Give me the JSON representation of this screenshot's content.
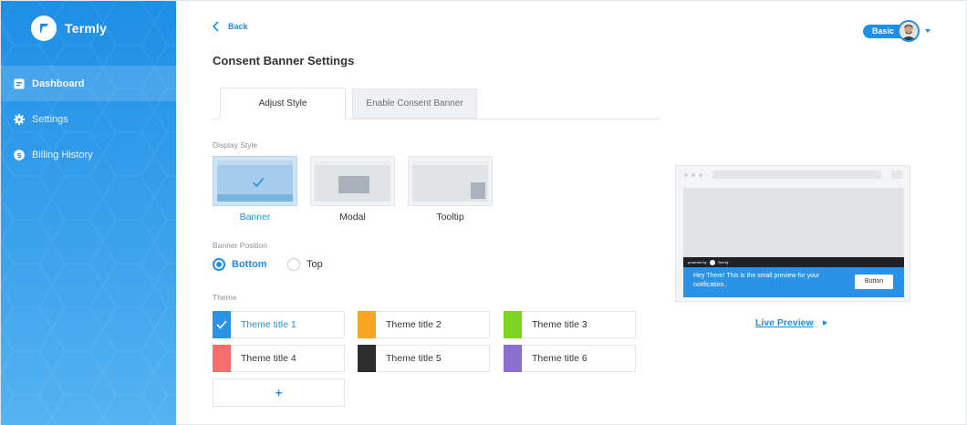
{
  "brand": {
    "name": "Termly"
  },
  "sidebar": {
    "items": [
      {
        "label": "Dashboard",
        "icon": "dashboard-icon",
        "active": true
      },
      {
        "label": "Settings",
        "icon": "gear-icon",
        "active": false
      },
      {
        "label": "Billing History",
        "icon": "dollar-icon",
        "active": false
      }
    ]
  },
  "header": {
    "back_label": "Back",
    "page_title": "Consent Banner Settings",
    "plan_label": "Basic"
  },
  "tabs": [
    {
      "label": "Adjust Style",
      "active": true
    },
    {
      "label": "Enable Consent Banner",
      "active": false
    }
  ],
  "display_style": {
    "label": "Display Style",
    "options": [
      {
        "name": "Banner",
        "selected": true
      },
      {
        "name": "Modal",
        "selected": false
      },
      {
        "name": "Tooltip",
        "selected": false
      }
    ]
  },
  "banner_position": {
    "label": "Banner Position",
    "options": [
      {
        "name": "Bottom",
        "selected": true
      },
      {
        "name": "Top",
        "selected": false
      }
    ]
  },
  "theme": {
    "label": "Theme",
    "options": [
      {
        "name": "Theme title 1",
        "color": "#2a93e8",
        "selected": true
      },
      {
        "name": "Theme title 2",
        "color": "#f5a623",
        "selected": false
      },
      {
        "name": "Theme title 3",
        "color": "#7ed321",
        "selected": false
      },
      {
        "name": "Theme title 4",
        "color": "#f76c6c",
        "selected": false
      },
      {
        "name": "Theme title 5",
        "color": "#2d2d2d",
        "selected": false
      },
      {
        "name": "Theme title 6",
        "color": "#8a6fcf",
        "selected": false
      }
    ],
    "add_label": "+"
  },
  "preview": {
    "powered_text": "powered by",
    "powered_brand": "Termly",
    "message": "Hey There! This is the small preview for your notification..",
    "button_label": "Button",
    "live_preview_label": "Live Preview"
  },
  "colors": {
    "accent": "#1e8fe6"
  }
}
